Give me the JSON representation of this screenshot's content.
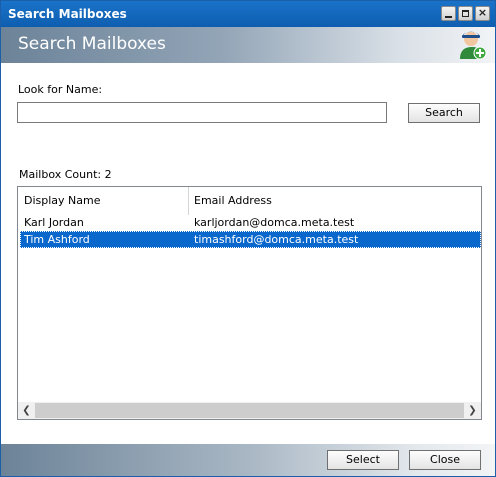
{
  "window": {
    "title": "Search Mailboxes"
  },
  "header": {
    "title": "Search Mailboxes",
    "icon": "user-add-icon"
  },
  "search": {
    "label": "Look for Name:",
    "value": "",
    "placeholder": "",
    "button_label": "Search"
  },
  "results": {
    "count_label": "Mailbox Count: 2",
    "columns": [
      "Display Name",
      "Email Address"
    ],
    "rows": [
      {
        "name": "Karl Jordan",
        "email": "karljordan@domca.meta.test",
        "selected": false
      },
      {
        "name": "Tim Ashford",
        "email": "timashford@domca.meta.test",
        "selected": true
      }
    ]
  },
  "footer": {
    "select_label": "Select",
    "close_label": "Close"
  },
  "colors": {
    "titlebar": "#0e5eb0",
    "selection": "#0a68cd"
  }
}
